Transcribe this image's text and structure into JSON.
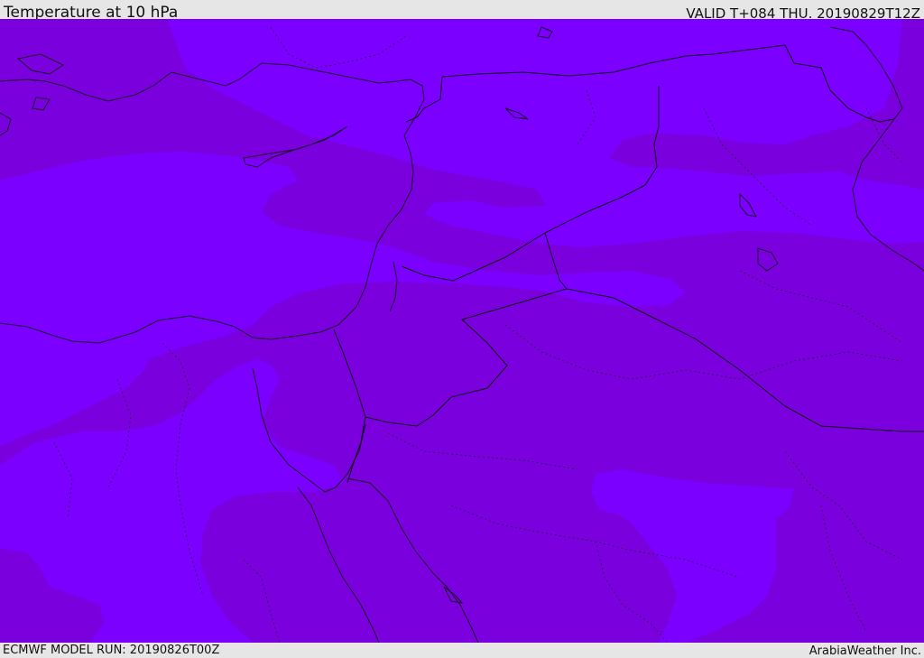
{
  "header": {
    "title": "Temperature at 10 hPa",
    "valid": "VALID T+084 THU. 20190829T12Z"
  },
  "footer": {
    "model_run": "ECMWF MODEL RUN: 20190826T00Z",
    "credit": "ArabiaWeather Inc."
  },
  "colors": {
    "warm_band": "#7b00ff",
    "cool_band": "#7a00dd",
    "coastline": "#1a0a2a",
    "background": "#e6e6e6"
  }
}
